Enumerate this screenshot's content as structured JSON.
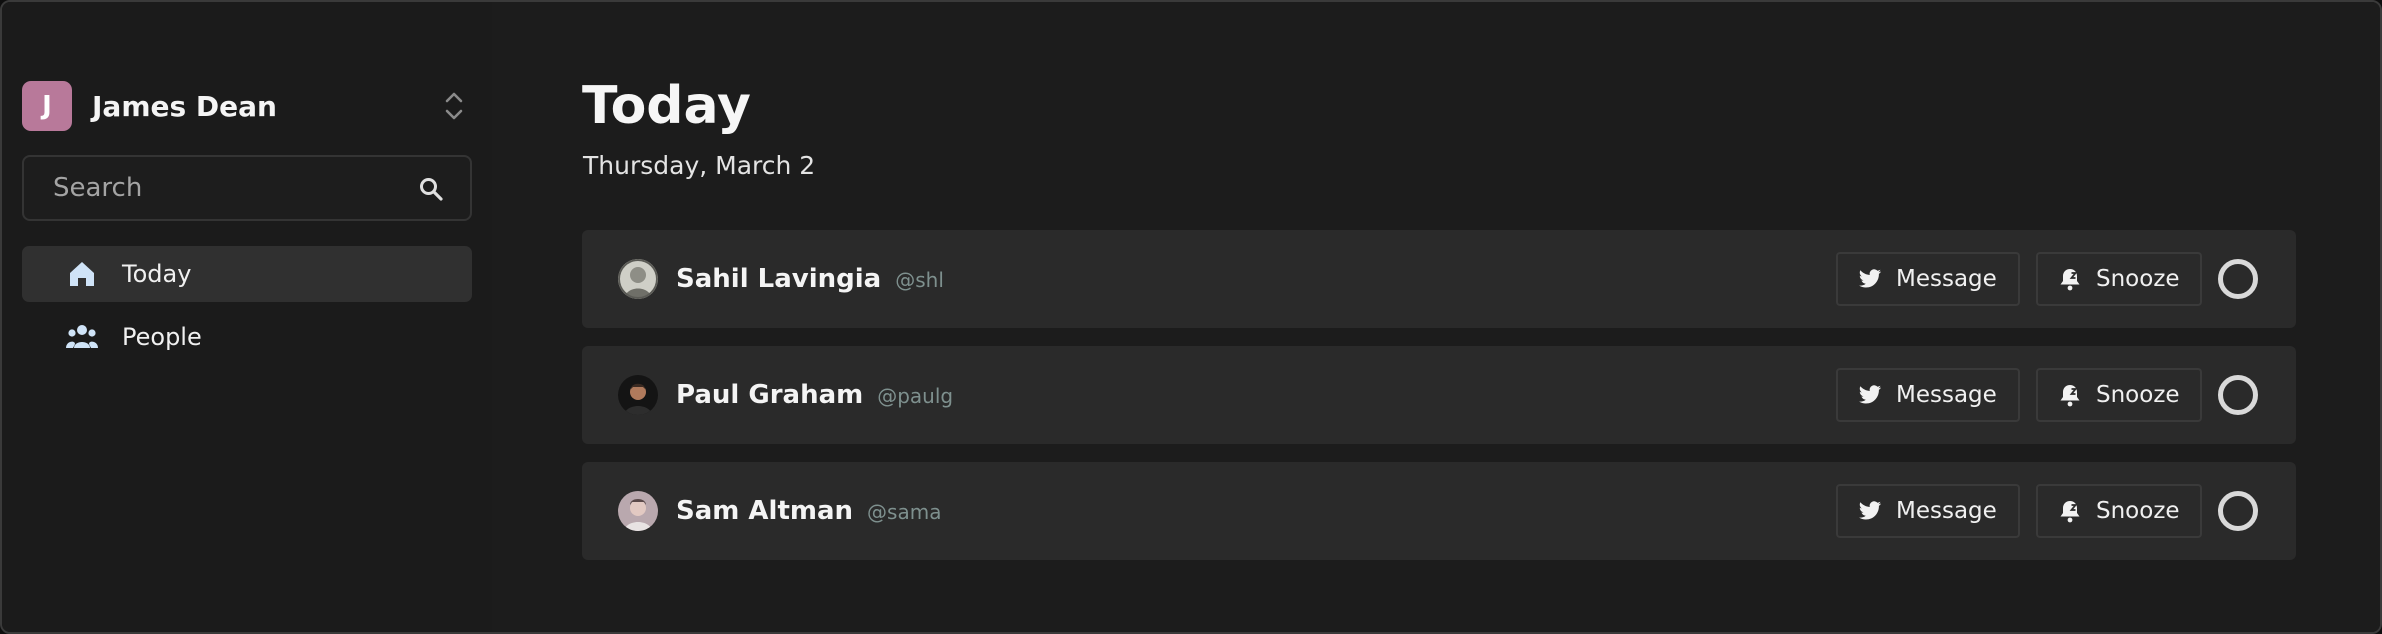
{
  "account": {
    "initial": "J",
    "name": "James Dean",
    "avatar_color": "#b8799a"
  },
  "search": {
    "placeholder": "Search"
  },
  "nav": [
    {
      "label": "Today",
      "icon": "home-icon",
      "active": true
    },
    {
      "label": "People",
      "icon": "people-icon",
      "active": false
    }
  ],
  "page": {
    "title": "Today",
    "date": "Thursday, March 2"
  },
  "people": [
    {
      "name": "Sahil Lavingia",
      "handle": "@shl",
      "message_label": "Message",
      "snooze_label": "Snooze"
    },
    {
      "name": "Paul Graham",
      "handle": "@paulg",
      "message_label": "Message",
      "snooze_label": "Snooze"
    },
    {
      "name": "Sam Altman",
      "handle": "@sama",
      "message_label": "Message",
      "snooze_label": "Snooze"
    }
  ],
  "colors": {
    "background": "#1c1c1c",
    "card": "#2a2a2a",
    "handle": "#7e908e",
    "accent_avatar": "#b8799a"
  }
}
